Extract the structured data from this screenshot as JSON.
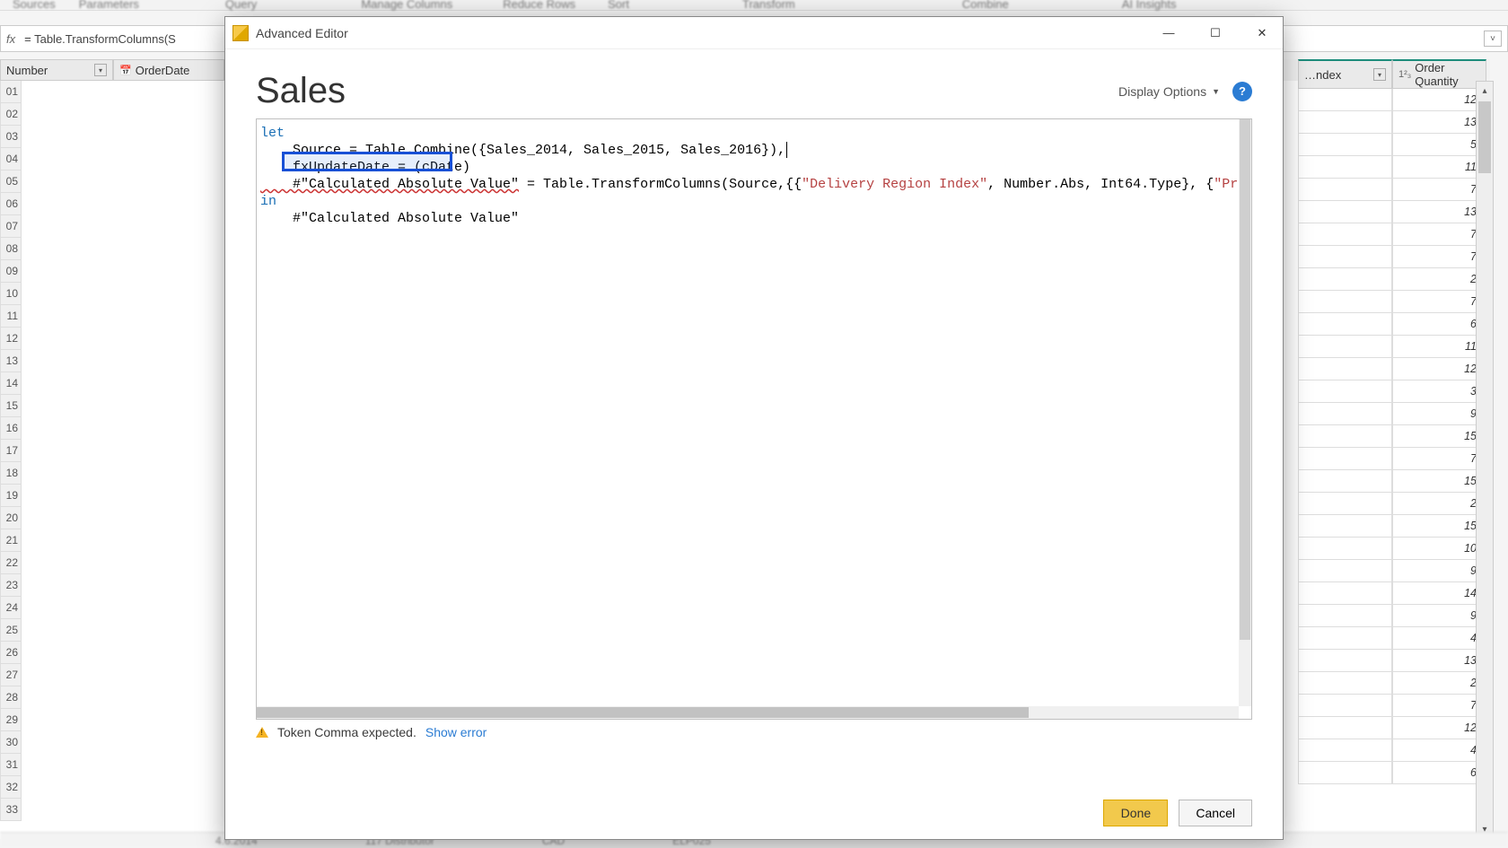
{
  "ribbon": {
    "groups": [
      "Sources",
      "Parameters",
      "Query",
      "Manage Columns",
      "Reduce Rows",
      "Sort",
      "Transform",
      "Combine",
      "AI Insights"
    ]
  },
  "formula_bar": {
    "fx": "fx",
    "text": "= Table.TransformColumns(S"
  },
  "grid": {
    "left_column": "Number",
    "second_column": "OrderDate",
    "row_nums": [
      "01",
      "02",
      "03",
      "04",
      "05",
      "06",
      "07",
      "08",
      "09",
      "10",
      "11",
      "12",
      "13",
      "14",
      "15",
      "16",
      "17",
      "18",
      "19",
      "20",
      "21",
      "22",
      "23",
      "24",
      "25",
      "26",
      "27",
      "28",
      "29",
      "30",
      "31",
      "32",
      "33"
    ],
    "right_col_a": "…ndex",
    "right_col_b": "Order Quantity",
    "right_values": [
      "12",
      "13",
      "5",
      "11",
      "7",
      "13",
      "7",
      "7",
      "2",
      "7",
      "6",
      "11",
      "12",
      "3",
      "9",
      "15",
      "7",
      "15",
      "2",
      "15",
      "10",
      "9",
      "14",
      "9",
      "4",
      "13",
      "2",
      "7",
      "12",
      "4",
      "6"
    ]
  },
  "modal": {
    "title": "Advanced Editor",
    "query_name": "Sales",
    "display_options": "Display Options",
    "help_tooltip": "?",
    "code": {
      "line1_kw": "let",
      "line2_pre": "    Source = Table.Combine({Sales_2014, Sales_2015, Sales_2016}),",
      "line3_highlight": "fxUpdateDate = (cDate)",
      "line4_err": "    #\"Calculated Absolute Value\"",
      "line4_mid": " = Table.TransformColumns(Source,{{",
      "line4_str1": "\"Delivery Region Index\"",
      "line4_mid2": ", Number.Abs, Int64.Type}, {",
      "line4_str2": "\"Product Description I",
      "line5_kw": "in",
      "line6": "    #\"Calculated Absolute Value\""
    },
    "error_msg": "Token Comma expected.",
    "show_error": "Show error",
    "done": "Done",
    "cancel": "Cancel"
  },
  "status": {
    "a": "4.6.2014",
    "b": "117 Distributor",
    "c": "CAD",
    "d": "ELP025"
  }
}
